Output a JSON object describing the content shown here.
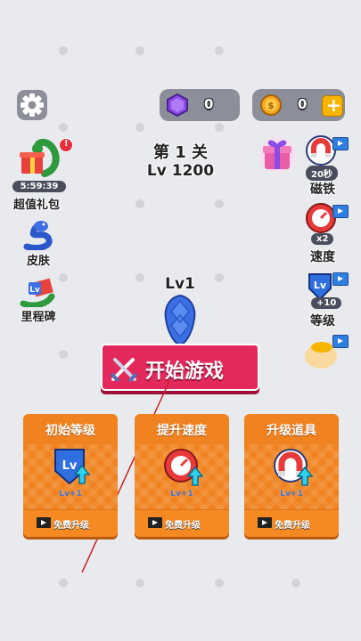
{
  "currency": {
    "gems": "0",
    "coins": "0"
  },
  "level": {
    "stage": "第 1 关",
    "power": "Lv 1200"
  },
  "left_menu": {
    "gift": {
      "timer": "5:59:39",
      "label": "超值礼包"
    },
    "skins": {
      "label": "皮肤"
    },
    "milestone": {
      "label": "里程碑"
    }
  },
  "right_menu": {
    "magnet": {
      "badge": "20秒",
      "label": "磁铁"
    },
    "speed": {
      "badge": "x2",
      "label": "速度"
    },
    "level": {
      "badge": "+10",
      "label": "等级"
    }
  },
  "player": {
    "level": "Lv1"
  },
  "start_button": {
    "label": "开始游戏"
  },
  "cards": [
    {
      "title": "初始等级",
      "lv": "Lv+1",
      "button": "免费升级"
    },
    {
      "title": "提升速度",
      "lv": "Lv+1",
      "button": "免费升级"
    },
    {
      "title": "升级道具",
      "lv": "Lv+1",
      "button": "免费升级"
    }
  ],
  "icons": {
    "lv_shield_text": "Lv"
  },
  "colors": {
    "accent": "#e3285c",
    "card": "#f0821f",
    "gem": "#8a4be6",
    "coin": "#f5a623"
  }
}
